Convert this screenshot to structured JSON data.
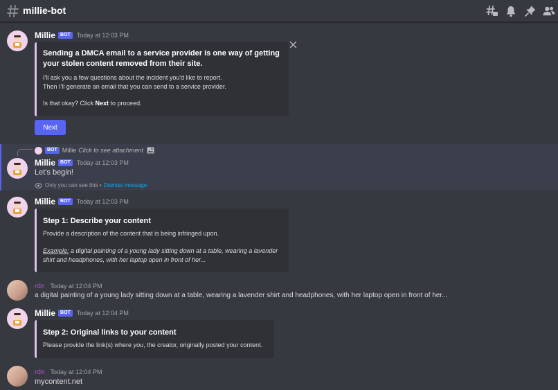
{
  "header": {
    "channel_name": "millie-bot",
    "icons": [
      "threads-icon",
      "bell-icon",
      "pin-icon",
      "members-icon"
    ]
  },
  "colors": {
    "background": "#36393f",
    "embed_background": "#2f3136",
    "embed_accent": "#dfbdee",
    "blurple": "#5865f2",
    "link": "#00aff4",
    "user_name": "#a855c5"
  },
  "messages": {
    "m1": {
      "author": "Millie",
      "tag": "BOT",
      "timestamp": "Today at 12:03 PM",
      "embed_title": "Sending a DMCA email to a service provider is one way of getting your stolen content removed from their site.",
      "line1": "I'll ask you a few questions about the incident you'd like to report.",
      "line2": "Then I'll generate an email that you can send to a service provider.",
      "proceed_pre": "Is that okay? Click ",
      "proceed_bold": "Next",
      "proceed_post": " to proceed.",
      "button_label": "Next"
    },
    "reply": {
      "tag": "BOT",
      "author": "Millie",
      "text": "Click to see attachment"
    },
    "m2": {
      "author": "Millie",
      "tag": "BOT",
      "timestamp": "Today at 12:03 PM",
      "text": "Let's begin!",
      "ephemeral_text": "Only you can see this •",
      "dismiss_label": "Dismiss message"
    },
    "m3": {
      "author": "Millie",
      "tag": "BOT",
      "timestamp": "Today at 12:03 PM",
      "embed_title": "Step 1: Describe your content",
      "description": "Provide a description of the content that is being infringed upon.",
      "example_label": "Example:",
      "example_text": " a digital painting of a young lady sitting down at a table, wearing a lavender shirt and headphones, with her laptop open in front of her..."
    },
    "m4": {
      "author": "rde",
      "timestamp": "Today at 12:04 PM",
      "text": "a digital painting of a young lady sitting down at a table, wearing a lavender shirt and headphones, with her laptop open in front of her..."
    },
    "m5": {
      "author": "Millie",
      "tag": "BOT",
      "timestamp": "Today at 12:04 PM",
      "embed_title": "Step 2: Original links to your content",
      "desc_pre": "Please provide the link(s) where ",
      "desc_em": "you",
      "desc_post": ", the creator, originally posted your content."
    },
    "m6": {
      "author": "rde",
      "timestamp": "Today at 12:04 PM",
      "text": "mycontent.net"
    }
  }
}
